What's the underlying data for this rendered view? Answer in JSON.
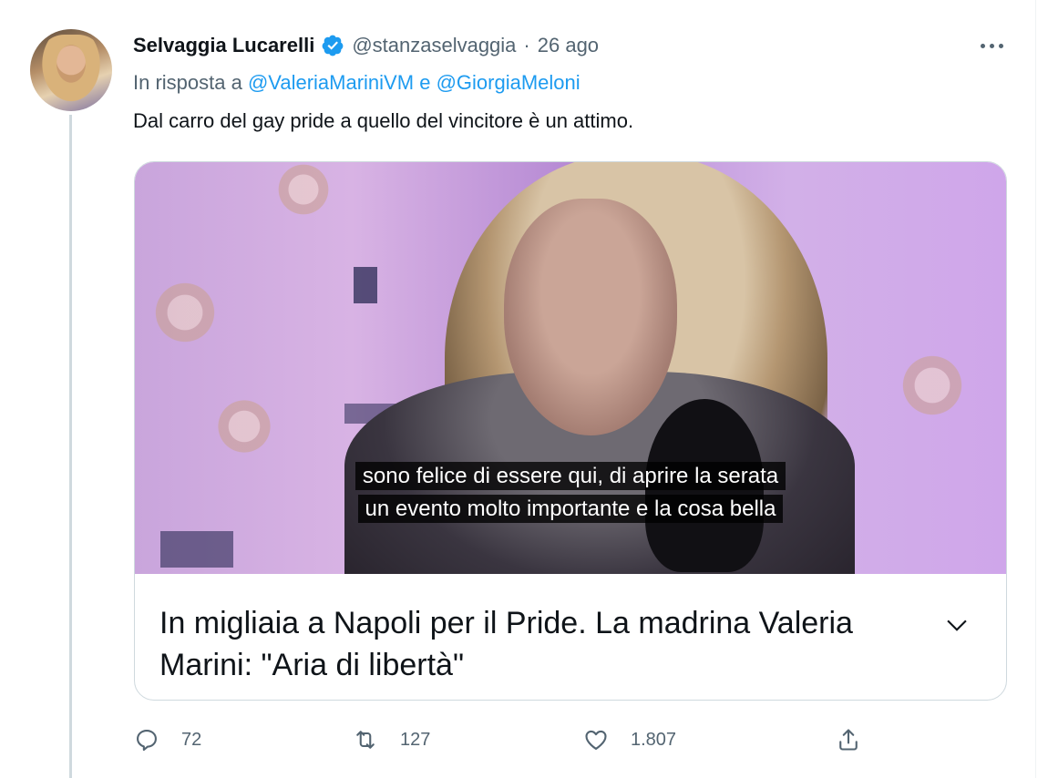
{
  "tweet": {
    "author_name": "Selvaggia Lucarelli",
    "handle": "@stanzaselvaggia",
    "separator": "·",
    "date": "26 ago",
    "reply_prefix": "In risposta a",
    "reply_mention_1": "@ValeriaMariniVM",
    "reply_conjunction": "e",
    "reply_mention_2": "@GiorgiaMeloni",
    "text": "Dal carro del gay pride a quello del vincitore è un attimo."
  },
  "card": {
    "subtitle_line_1": "sono felice di essere qui, di aprire la serata",
    "subtitle_line_2": "un evento molto importante e la cosa bella",
    "title": "In migliaia a Napoli per il Pride. La madrina Valeria Marini: \"Aria di libertà\""
  },
  "actions": {
    "replies": "72",
    "retweets": "127",
    "likes": "1.807"
  },
  "colors": {
    "accent": "#1d9bf0",
    "secondary_text": "#536471",
    "primary_text": "#0f1419",
    "border": "#cfd9de"
  },
  "icons": [
    "verified-badge-icon",
    "more-options-icon",
    "chevron-down-icon",
    "reply-icon",
    "retweet-icon",
    "like-icon",
    "share-icon"
  ]
}
